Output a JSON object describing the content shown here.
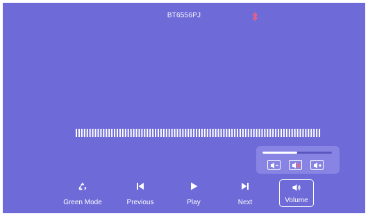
{
  "header": {
    "device_name": "BT6556PJ",
    "status_icon": "bluetooth-icon",
    "status_color": "#f06080"
  },
  "theme": {
    "background": "#6e6ad8",
    "panel": "#8784e4",
    "foreground": "#ffffff",
    "accent_red": "#f06080"
  },
  "progress": {
    "kind": "audio-level-ticks",
    "tick_count": 90
  },
  "volume_panel": {
    "level_fraction": 0.5,
    "buttons": [
      {
        "icon": "volume-down-icon",
        "accent": false
      },
      {
        "icon": "volume-mute-icon",
        "accent": true
      },
      {
        "icon": "volume-up-icon",
        "accent": false
      }
    ]
  },
  "controls": [
    {
      "id": "green-mode",
      "label": "Green Mode",
      "icon": "recycle-icon"
    },
    {
      "id": "previous",
      "label": "Previous",
      "icon": "skip-previous-icon"
    },
    {
      "id": "play",
      "label": "Play",
      "icon": "play-icon"
    },
    {
      "id": "next",
      "label": "Next",
      "icon": "skip-next-icon"
    },
    {
      "id": "volume",
      "label": "Volume",
      "icon": "speaker-icon",
      "selected": true
    }
  ]
}
